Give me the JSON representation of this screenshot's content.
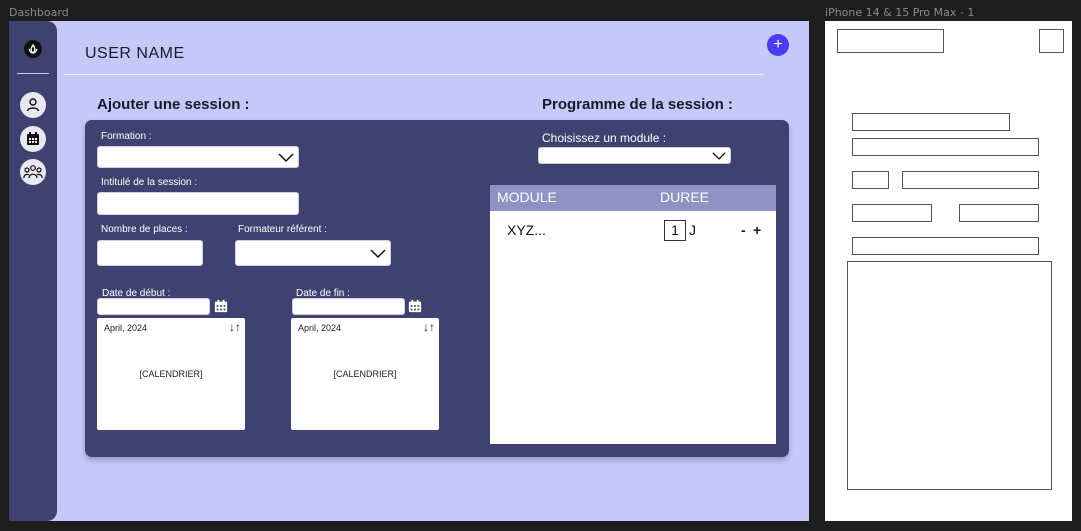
{
  "frames": {
    "dashboard_label": "Dashboard",
    "phone_label": "iPhone 14 & 15 Pro Max - 1"
  },
  "header": {
    "username": "USER NAME",
    "add_button": "+"
  },
  "sidebar": {
    "items": [
      {
        "icon": "user-icon"
      },
      {
        "icon": "calendar-icon"
      },
      {
        "icon": "group-icon"
      }
    ]
  },
  "form": {
    "title": "Ajouter une session :",
    "formation_label": "Formation :",
    "formation_value": "",
    "intitule_label": "Intitulé de la session :",
    "intitule_value": "",
    "places_label": "Nombre de places :",
    "places_value": "",
    "formateur_label": "Formateur référent :",
    "formateur_value": "",
    "date_debut_label": "Date de début :",
    "date_debut_value": "",
    "date_fin_label": "Date de fin :",
    "date_fin_value": "",
    "calendar_debut": {
      "month": "April, 2024",
      "sort": "↓↑",
      "placeholder": "[CALENDRIER]"
    },
    "calendar_fin": {
      "month": "April, 2024",
      "sort": "↓↑",
      "placeholder": "[CALENDRIER]"
    }
  },
  "programme": {
    "title": "Programme de la session :",
    "module_select_label": "Choisissez un module :",
    "module_select_value": "",
    "columns": [
      "MODULE",
      "DUREE"
    ],
    "rows": [
      {
        "module": "XYZ...",
        "duree": "1",
        "unit": "J",
        "minus": "-",
        "plus": "+"
      }
    ]
  },
  "colors": {
    "background": "#c7c8fa",
    "panel": "#3f4270",
    "accent": "#4a3cf0"
  }
}
